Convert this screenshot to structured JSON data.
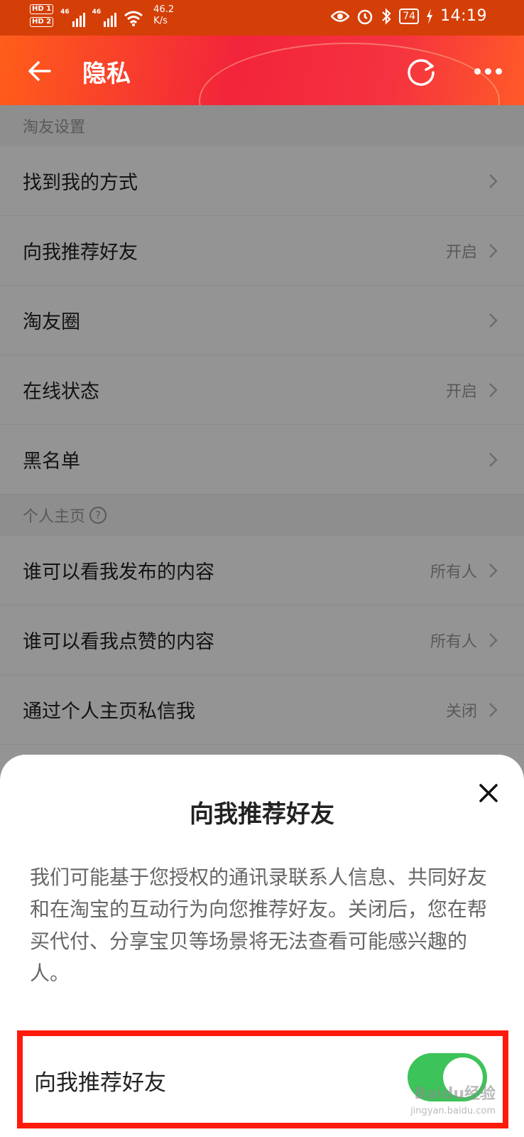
{
  "status_bar": {
    "hd1": "HD 1",
    "hd2": "HD 2",
    "net1": "46",
    "net2": "46",
    "speed": "46.2",
    "speed_unit": "K/s",
    "battery": "74",
    "time": "14:19"
  },
  "header": {
    "title": "隐私"
  },
  "sections": {
    "friends": {
      "title": "淘友设置",
      "items": [
        {
          "label": "找到我的方式",
          "value": ""
        },
        {
          "label": "向我推荐好友",
          "value": "开启"
        },
        {
          "label": "淘友圈",
          "value": ""
        },
        {
          "label": "在线状态",
          "value": "开启"
        },
        {
          "label": "黑名单",
          "value": ""
        }
      ]
    },
    "profile": {
      "title": "个人主页",
      "help": "?",
      "items": [
        {
          "label": "谁可以看我发布的内容",
          "value": "所有人"
        },
        {
          "label": "谁可以看我点赞的内容",
          "value": "所有人"
        },
        {
          "label": "通过个人主页私信我",
          "value": "关闭"
        }
      ]
    }
  },
  "sheet": {
    "title": "向我推荐好友",
    "description": "我们可能基于您授权的通讯录联系人信息、共同好友和在淘宝的互动行为向您推荐好友。关闭后，您在帮买代付、分享宝贝等场景将无法查看可能感兴趣的人。",
    "toggle_label": "向我推荐好友",
    "toggle_on": true
  },
  "watermark": {
    "brand": "Baidu经验",
    "url": "jingyan.baidu.com"
  },
  "colors": {
    "accent": "#ff5000",
    "toggle_on": "#3cc35a",
    "highlight": "#ff1a0c"
  }
}
